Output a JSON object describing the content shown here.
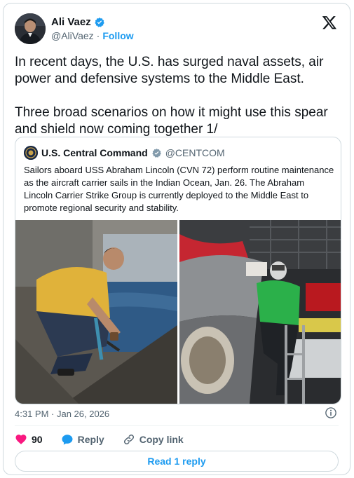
{
  "author": {
    "display_name": "Ali Vaez",
    "handle": "@AliVaez",
    "separator": "·",
    "follow_label": "Follow"
  },
  "tweet": {
    "text": "In recent days, the U.S. has surged naval assets, air power and defensive systems to the Middle East.\n\nThree broad scenarios on how it might use this spear and shield now coming together 1/"
  },
  "quoted": {
    "display_name": "U.S. Central Command",
    "handle": "@CENTCOM",
    "text": "Sailors aboard USS Abraham Lincoln (CVN 72) perform routine maintenance as the aircraft carrier sails in the Indian Ocean, Jan. 26. The Abraham Lincoln Carrier Strike Group is currently deployed to the Middle East to promote regional security and stability."
  },
  "meta": {
    "timestamp": "4:31 PM · Jan 26, 2026"
  },
  "actions": {
    "like_count": "90",
    "reply_label": "Reply",
    "copy_label": "Copy link",
    "read_replies_label": "Read 1 reply"
  },
  "colors": {
    "accent": "#1d9bf0",
    "like": "#f91880",
    "muted": "#536471",
    "border": "#cfd9de"
  }
}
